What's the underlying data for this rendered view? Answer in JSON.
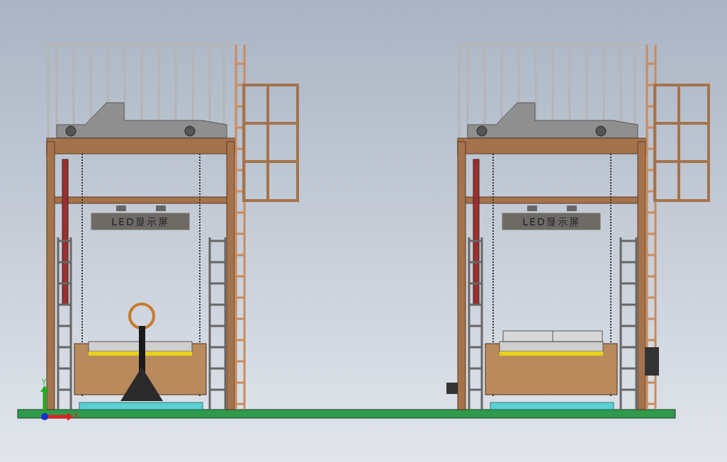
{
  "viewport": {
    "towers": [
      {
        "sign_label": "LED显示屏",
        "kind": "pallet-jack"
      },
      {
        "sign_label": "LED显示屏",
        "kind": "pallet-stack"
      }
    ],
    "axes": {
      "y_label": "Y",
      "x_label": "X"
    }
  }
}
